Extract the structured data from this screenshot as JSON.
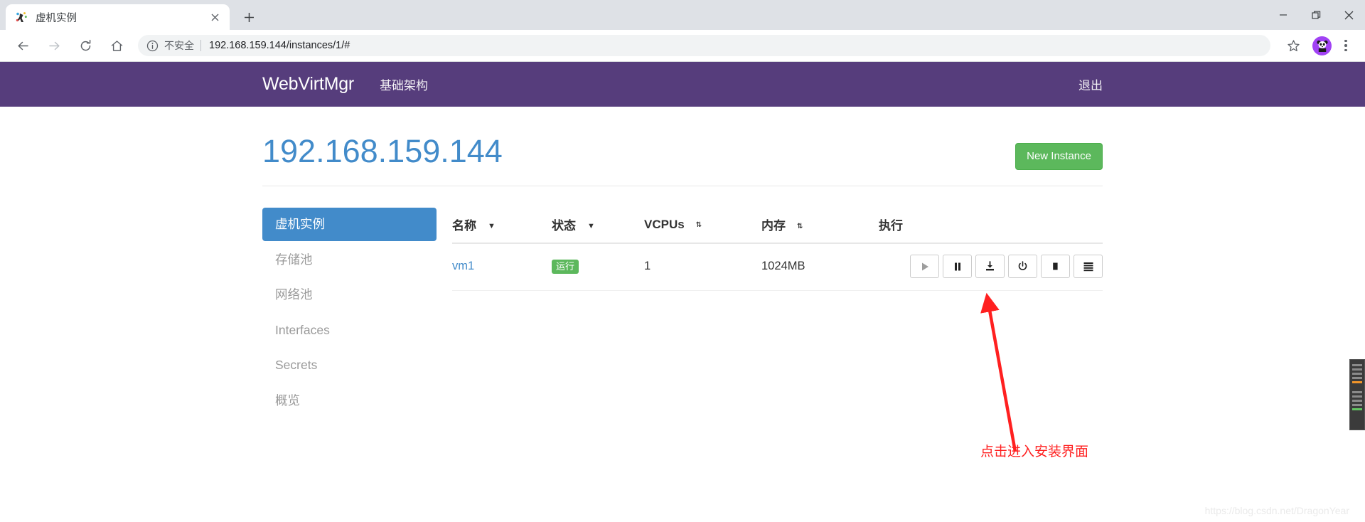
{
  "browser": {
    "tab": {
      "title": "虚机实例",
      "favicon_icon": "webvirtmgr-favicon",
      "close_icon": "close-icon"
    },
    "new_tab_label": "+",
    "window_controls": {
      "minimize": "minimize-icon",
      "maximize": "maximize-icon",
      "close": "close-icon"
    },
    "toolbar": {
      "back_icon": "back-arrow-icon",
      "forward_icon": "forward-arrow-icon",
      "reload_icon": "reload-icon",
      "home_icon": "home-icon",
      "security_icon": "info-circle-icon",
      "security_label": "不安全",
      "url": "192.168.159.144/instances/1/#",
      "bookmark_icon": "star-icon",
      "profile_icon": "panda-avatar-icon",
      "menu_icon": "three-dot-menu-icon"
    }
  },
  "navbar": {
    "brand": "WebVirtMgr",
    "links": [
      {
        "label": "基础架构"
      }
    ],
    "logout_label": "退出",
    "background": "#563d7c"
  },
  "header": {
    "title": "192.168.159.144",
    "title_color": "#428bca",
    "new_instance_label": "New Instance",
    "new_instance_color": "#5cb85c"
  },
  "sidebar": {
    "items": [
      {
        "label": "虚机实例",
        "active": true
      },
      {
        "label": "存储池",
        "active": false
      },
      {
        "label": "网络池",
        "active": false
      },
      {
        "label": "Interfaces",
        "active": false
      },
      {
        "label": "Secrets",
        "active": false
      },
      {
        "label": "概览",
        "active": false
      }
    ],
    "active_color": "#428bca"
  },
  "table": {
    "columns": [
      {
        "label": "名称",
        "sort": "desc"
      },
      {
        "label": "状态",
        "sort": "desc"
      },
      {
        "label": "VCPUs",
        "sort": "both"
      },
      {
        "label": "内存",
        "sort": "both"
      },
      {
        "label": "执行",
        "sort": "none"
      }
    ],
    "rows": [
      {
        "name": "vm1",
        "state": "运行",
        "state_color": "#5cb85c",
        "vcpus": "1",
        "memory": "1024MB",
        "actions": [
          {
            "icon": "play-icon",
            "disabled": true
          },
          {
            "icon": "pause-icon",
            "disabled": false
          },
          {
            "icon": "install-download-icon",
            "disabled": false
          },
          {
            "icon": "power-icon",
            "disabled": false
          },
          {
            "icon": "stop-icon",
            "disabled": false
          },
          {
            "icon": "hamburger-menu-icon",
            "disabled": false
          }
        ]
      }
    ]
  },
  "annotation": {
    "text": "点击进入安装界面",
    "color": "#ff2020"
  },
  "watermark": {
    "text": "https://blog.csdn.net/DragonYear"
  },
  "edge_panel": {
    "name": "floating-side-widget"
  }
}
